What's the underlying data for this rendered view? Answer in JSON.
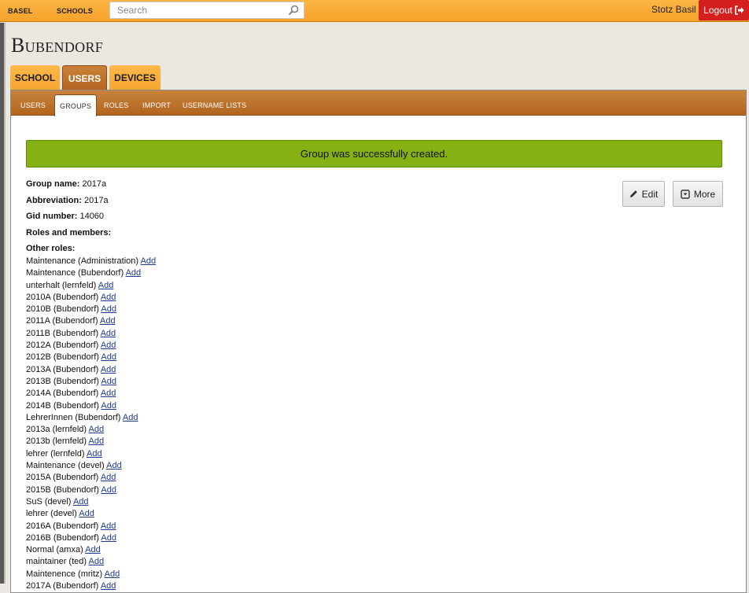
{
  "topbar": {
    "nav": [
      "BASEL",
      "SCHOOLS"
    ],
    "search_placeholder": "Search",
    "user_name": "Stotz Basil",
    "logout_label": "Logout"
  },
  "page": {
    "title": "Bubendorf"
  },
  "main_tabs": [
    {
      "label": "SCHOOL",
      "active": false
    },
    {
      "label": "USERS",
      "active": true
    },
    {
      "label": "DEVICES",
      "active": false
    }
  ],
  "sub_tabs": [
    {
      "label": "USERS",
      "active": false
    },
    {
      "label": "GROUPS",
      "active": true
    },
    {
      "label": "ROLES",
      "active": false
    },
    {
      "label": "IMPORT",
      "active": false
    },
    {
      "label": "USERNAME LISTS",
      "active": false
    }
  ],
  "alert": {
    "message": "Group was successfully created."
  },
  "group": {
    "name_label": "Group name:",
    "name": "2017a",
    "abbr_label": "Abbreviation:",
    "abbr": "2017a",
    "gid_label": "Gid number:",
    "gid": "14060",
    "roles_members_label": "Roles and members:",
    "other_roles_label": "Other roles:"
  },
  "actions": {
    "edit_label": "Edit",
    "more_label": "More"
  },
  "add_label": "Add",
  "other_roles": [
    "Maintenance (Administration)",
    "Maintenance (Bubendorf)",
    "unterhalt (lernfeld)",
    "2010A (Bubendorf)",
    "2010B (Bubendorf)",
    "2011A (Bubendorf)",
    "2011B (Bubendorf)",
    "2012A (Bubendorf)",
    "2012B (Bubendorf)",
    "2013A (Bubendorf)",
    "2013B (Bubendorf)",
    "2014A (Bubendorf)",
    "2014B (Bubendorf)",
    "LehrerInnen (Bubendorf)",
    "2013a (lernfeld)",
    "2013b (lernfeld)",
    "lehrer (lernfeld)",
    "Maintenance (devel)",
    "2015A (Bubendorf)",
    "2015B (Bubendorf)",
    "SuS (devel)",
    "lehrer (devel)",
    "2016A (Bubendorf)",
    "2016B (Bubendorf)",
    "Normal (amxa)",
    "maintainer (ted)",
    "Maintenence (mritz)",
    "2017A (Bubendorf)"
  ],
  "colors": {
    "topbar": "#f6a32b",
    "active_tab": "#b4641f",
    "alert_bg": "#85b112",
    "logout_bg": "#d51f1f",
    "link": "#1f3a93"
  }
}
